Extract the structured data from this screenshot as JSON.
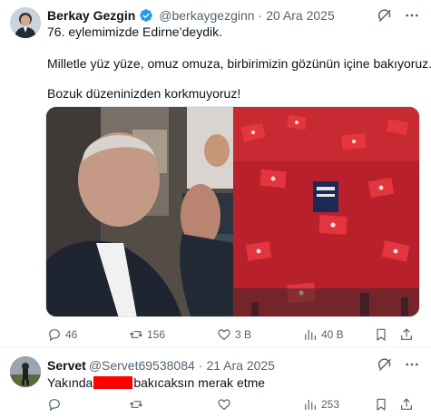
{
  "main_tweet": {
    "author_name": "Berkay Gezgin",
    "handle": "@berkaygezginn",
    "separator": "·",
    "date": "20 Ara 2025",
    "lines": [
      "76. eylemimizde Edirne’deydik.",
      "Milletle yüz yüze, omuz omuza, birbirimizin gözünün içine bakıyoruz.",
      "Bozuk düzeninizden korkmuyoruz!"
    ],
    "stats": {
      "replies": "46",
      "reposts": "156",
      "likes": "3 B",
      "views": "40 B"
    },
    "accent_color": "#1d9bf0",
    "icons": [
      "verified-badge-icon",
      "grok-icon",
      "more-icon",
      "reply-icon",
      "repost-icon",
      "like-icon",
      "views-icon",
      "bookmark-icon",
      "share-icon"
    ]
  },
  "reply_tweet": {
    "author_name": "Servet",
    "handle": "@Servet69538084",
    "separator": "·",
    "date": "21 Ara 2025",
    "text_before": "Yakında",
    "text_after": "bakıcaksın merak etme",
    "redaction_color": "#ff0000",
    "stats": {
      "views": "253"
    }
  }
}
